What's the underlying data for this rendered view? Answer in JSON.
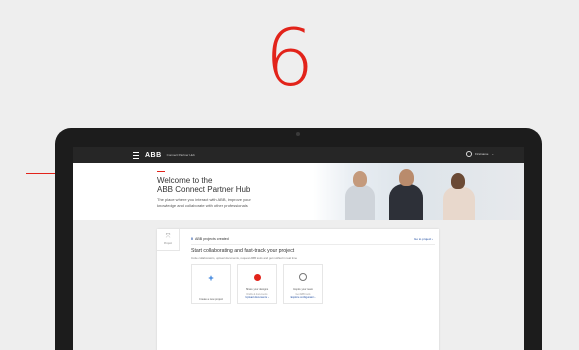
{
  "step": {
    "number": "6"
  },
  "colors": {
    "accent": "#e2231a",
    "link": "#1d4ba0",
    "plus": "#1d71d8"
  },
  "topbar": {
    "logo": "ABB",
    "app_title": "Connect Partner Hub",
    "user_name": "Firstname"
  },
  "hero": {
    "title_line1": "Welcome to the",
    "title_line2": "ABB Connect Partner Hub",
    "text_line1": "The place where you interact with ABB, improve your",
    "text_line2": "knowledge and collaborate with other professionals"
  },
  "card": {
    "side_tile_label": "Project",
    "header_count": "0",
    "header_text": "ABB projects created",
    "header_link": "Go to project ›",
    "title": "Start collaborating and fast-track your project",
    "subtitle": "Invite collaborators, upload documents, request ABB tools and get notified in real time",
    "tiles": [
      {
        "icon": "plus-icon",
        "label": "Create a new project",
        "desc": "",
        "link": ""
      },
      {
        "icon": "document-icon",
        "label": "Share your designs",
        "desc": "Drafts & documents",
        "link": "Upload documents ›"
      },
      {
        "icon": "lightbulb-icon",
        "label": "Inspire your team",
        "desc": "Get ABB tools",
        "link": "Explore configurator ›"
      }
    ]
  }
}
